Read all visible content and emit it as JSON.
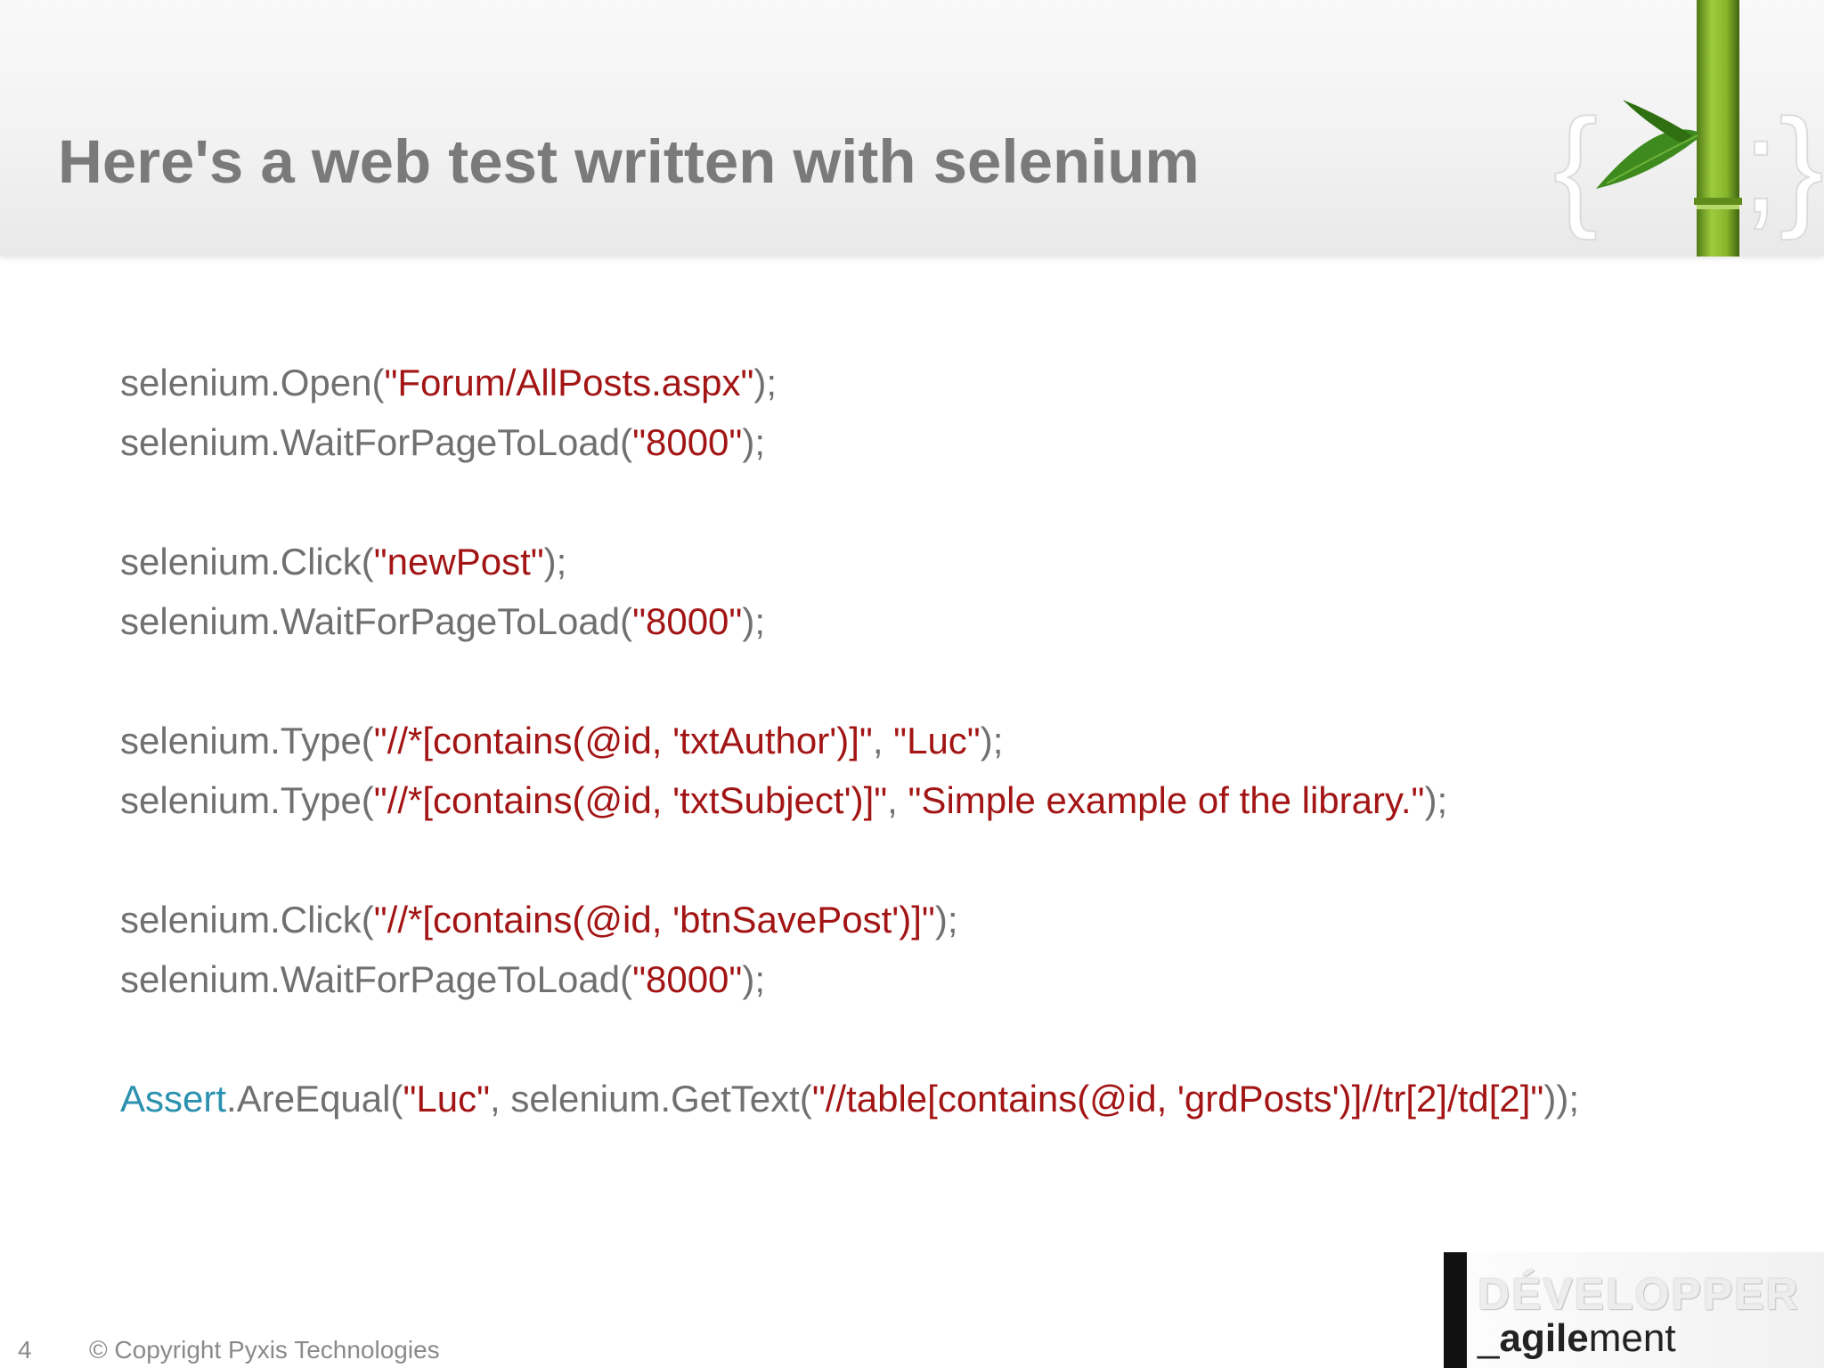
{
  "slide": {
    "title": "Here's a web test written with selenium",
    "number": "4",
    "copyright": "© Copyright Pyxis Technologies"
  },
  "code": {
    "l1": {
      "a": "selenium.Open(",
      "s": "\"Forum/AllPosts.aspx\"",
      "b": ");"
    },
    "l2": {
      "a": "selenium.WaitForPageToLoad(",
      "s": "\"8000\"",
      "b": ");"
    },
    "l3": {
      "a": "selenium.Click(",
      "s": "\"newPost\"",
      "b": ");"
    },
    "l4": {
      "a": "selenium.WaitForPageToLoad(",
      "s": "\"8000\"",
      "b": ");"
    },
    "l5": {
      "a": "selenium.Type(",
      "s1": "\"//*[contains(@id, 'txtAuthor')]\"",
      "m": ", ",
      "s2": "\"Luc\"",
      "b": ");"
    },
    "l6": {
      "a": "selenium.Type(",
      "s1": "\"//*[contains(@id, 'txtSubject')]\"",
      "m": ", ",
      "s2": "\"Simple example of the library.\"",
      "b": ");"
    },
    "l7": {
      "a": "selenium.Click(",
      "s": "\"//*[contains(@id, 'btnSavePost')]\"",
      "b": ");"
    },
    "l8": {
      "a": "selenium.WaitForPageToLoad(",
      "s": "\"8000\"",
      "b": ");"
    },
    "l9": {
      "k": "Assert",
      "a": ".AreEqual(",
      "s1": "\"Luc\"",
      "m": ", selenium.GetText(",
      "s2": "\"//table[contains(@id, 'grdPosts')]//tr[2]/td[2]\"",
      "b": "));"
    }
  },
  "colors": {
    "string": "#a31515",
    "keyword": "#2b91af",
    "code_text": "#707070",
    "title": "#7a7a7a"
  },
  "brand": {
    "top": "DÉVELOPPER",
    "bottom_prefix": "_",
    "bottom_bold": "agile",
    "bottom_rest": "ment"
  },
  "logo": {
    "icon": "bamboo-braces-icon",
    "brace_left": "{",
    "brace_right": ";}"
  }
}
